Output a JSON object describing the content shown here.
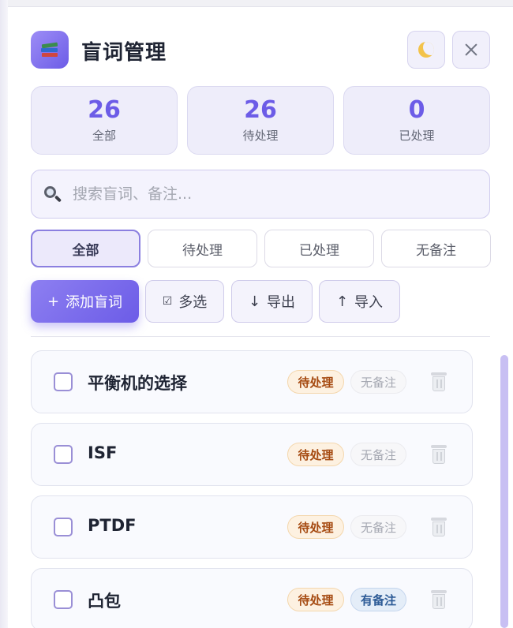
{
  "header": {
    "icon": "books-icon",
    "title": "盲词管理",
    "theme_icon": "moon-icon",
    "close_icon": "close-icon"
  },
  "stats": [
    {
      "value": "26",
      "label": "全部"
    },
    {
      "value": "26",
      "label": "待处理"
    },
    {
      "value": "0",
      "label": "已处理"
    }
  ],
  "search": {
    "icon": "search-icon",
    "placeholder": "搜索盲词、备注...",
    "value": ""
  },
  "filters": [
    {
      "label": "全部",
      "active": true
    },
    {
      "label": "待处理",
      "active": false
    },
    {
      "label": "已处理",
      "active": false
    },
    {
      "label": "无备注",
      "active": false
    }
  ],
  "actions": {
    "add": {
      "icon": "+",
      "label": "添加盲词"
    },
    "multi": {
      "icon": "☑",
      "label": "多选"
    },
    "export": {
      "icon": "↓",
      "label": "导出"
    },
    "import": {
      "icon": "↑",
      "label": "导入"
    }
  },
  "colors": {
    "accent": "#6c5ce7",
    "status_tag_text": "#a64b12",
    "has_note_text": "#2d5b96"
  },
  "items": [
    {
      "word": "平衡机的选择",
      "status": "待处理",
      "note": "无备注",
      "checked": false
    },
    {
      "word": "ISF",
      "status": "待处理",
      "note": "无备注",
      "checked": false
    },
    {
      "word": "PTDF",
      "status": "待处理",
      "note": "无备注",
      "checked": false
    },
    {
      "word": "凸包",
      "status": "待处理",
      "note": "有备注",
      "checked": false
    }
  ]
}
